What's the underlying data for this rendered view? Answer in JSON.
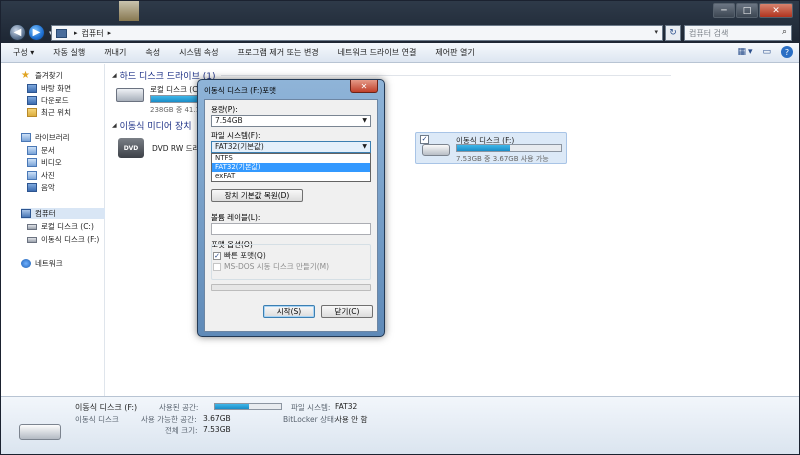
{
  "window": {
    "address_path": "컴퓨터",
    "search_placeholder": "컴퓨터 검색",
    "controls": [
      "─",
      "□",
      "✕"
    ]
  },
  "toolbar": {
    "items": [
      "구성 ▾",
      "자동 실행",
      "꺼내기",
      "속성",
      "시스템 속성",
      "프로그램 제거 또는 변경",
      "네트워크 드라이브 연결",
      "제어판 열기"
    ],
    "view_label": "▾"
  },
  "sidebar": {
    "favorites": "즐겨찾기",
    "desktop": "바탕 화면",
    "downloads": "다운로드",
    "recent": "최근 위치",
    "libraries": "라이브러리",
    "documents": "문서",
    "videos": "비디오",
    "pictures": "사진",
    "music": "음악",
    "computer": "컴퓨터",
    "local_disk": "로컬 디스크 (C:)",
    "removable_disk": "이동식 디스크 (F:)",
    "network": "네트워크"
  },
  "main": {
    "hdd_section": "하드 디스크 드라이브 (1)",
    "removable_section": "이동식 미디어 장치",
    "local_disk_name": "로컬 디스크 (C:)",
    "local_disk_size": "238GB 중 41.1GB",
    "local_disk_fill": 0.83,
    "dvd_name": "DVD RW 드라이브",
    "dvd_label": "DVD",
    "usb_name": "이동식 디스크 (F:)",
    "usb_size": "7.53GB 중 3.67GB 사용 가능",
    "usb_fill": 0.51,
    "usb_check": "✓"
  },
  "details": {
    "name": "이동식 디스크 (F:)",
    "type": "이동식 디스크",
    "used_label": "사용된 공간:",
    "free_label": "사용 가능한 공간:",
    "free_value": "3.67GB",
    "total_label": "전체 크기:",
    "total_value": "7.53GB",
    "fs_label": "파일 시스템:",
    "fs_value": "FAT32",
    "bitlocker_label": "BitLocker 상태:",
    "bitlocker_value": "사용 안 함",
    "used_fill": 0.51
  },
  "dialog": {
    "title": "이동식 디스크 (F:)포맷",
    "close": "✕",
    "capacity_label": "용량(P):",
    "capacity_value": "7.54GB",
    "fs_label": "파일 시스템(F):",
    "fs_value": "FAT32(기본값)",
    "fs_options": [
      "NTFS",
      "FAT32(기본값)",
      "exFAT"
    ],
    "restore_button": "장치 기본값 복원(D)",
    "volume_label": "볼륨 레이블(L):",
    "format_options": "포맷 옵션(O)",
    "quick_format": "빠른 포맷(Q)",
    "quick_check": "✓",
    "msdos_disk": "MS-DOS 시동 디스크 만들기(M)",
    "start_button": "시작(S)",
    "close_button": "닫기(C)"
  }
}
